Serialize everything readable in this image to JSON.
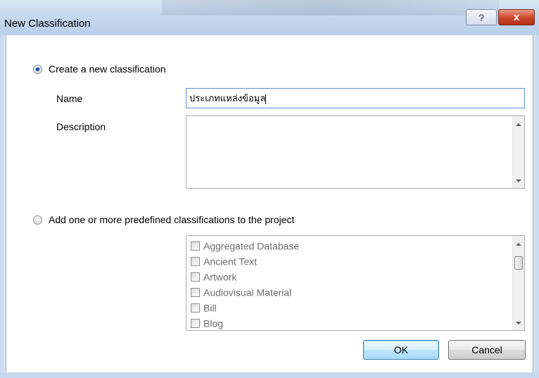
{
  "window": {
    "title": "New Classification",
    "help_label": "?",
    "close_label": "x"
  },
  "create_option": {
    "label": "Create a new classification",
    "selected": true,
    "name_label": "Name",
    "name_value": "ประเภทแหล่งข้อมูล",
    "description_label": "Description",
    "description_value": ""
  },
  "predefined_option": {
    "label": "Add one or more predefined classifications to the project",
    "selected": false,
    "items": [
      {
        "label": "Aggregated Database",
        "checked": false
      },
      {
        "label": "Ancient Text",
        "checked": false
      },
      {
        "label": "Artwork",
        "checked": false
      },
      {
        "label": "Audiovisual Material",
        "checked": false
      },
      {
        "label": "Bill",
        "checked": false
      },
      {
        "label": "Blog",
        "checked": false
      }
    ]
  },
  "buttons": {
    "ok_label": "OK",
    "cancel_label": "Cancel"
  }
}
